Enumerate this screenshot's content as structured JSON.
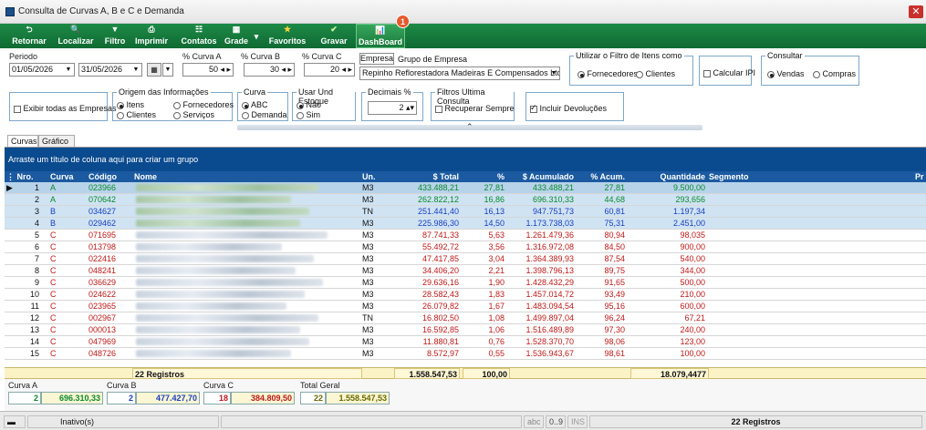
{
  "window": {
    "title": "Consulta de Curvas A, B e C e Demanda",
    "close": "✕"
  },
  "toolbar": {
    "items": [
      {
        "label": "Retornar",
        "icon": "back-arrow-icon",
        "glyph": "⮌"
      },
      {
        "label": "Localizar",
        "icon": "search-icon",
        "glyph": "🔍"
      },
      {
        "label": "Filtro",
        "icon": "filter-icon",
        "glyph": "▼"
      },
      {
        "label": "Imprimir",
        "icon": "printer-icon",
        "glyph": "⎙"
      },
      {
        "label": "Contatos",
        "icon": "contacts-icon",
        "glyph": "☷"
      },
      {
        "label": "Grade",
        "icon": "grid-icon",
        "glyph": "▦"
      },
      {
        "label": "Favoritos",
        "icon": "star-icon",
        "glyph": "★"
      },
      {
        "label": "Gravar",
        "icon": "check-icon",
        "glyph": "✔"
      },
      {
        "label": "DashBoard",
        "icon": "dashboard-icon",
        "glyph": "📊"
      }
    ],
    "badge": "1",
    "grade_arrow": "▾"
  },
  "filters": {
    "periodo_label": "Periodo",
    "date_from": "01/05/2026",
    "date_to": "31/05/2026",
    "curva_a_label": "% Curva A",
    "curva_a_value": "50",
    "curva_b_label": "% Curva B",
    "curva_b_value": "30",
    "curva_c_label": "% Curva C",
    "curva_c_value": "20",
    "empresa_tab": "Empresa",
    "grupo_tab": "Grupo de Empresa",
    "empresa_value": "Repinho Reflorestadora Madeiras E Compensados Ltda",
    "filtro_itens_title": "Utilizar o Filtro de Itens como",
    "opt_fornecedores": "Fornecedores",
    "opt_clientes": "Clientes",
    "calcular_ipi": "Calcular IPI",
    "consultar_title": "Consultar",
    "opt_vendas": "Vendas",
    "opt_compras": "Compras",
    "exibir_empresas": "Exibir todas as Empresas",
    "origem_title": "Origem das Informações",
    "origem_itens": "Itens",
    "origem_fornecedores": "Fornecedores",
    "origem_clientes": "Clientes",
    "origem_servicos": "Serviços",
    "curva_title": "Curva",
    "curva_abc": "ABC",
    "curva_demanda": "Demanda",
    "und_title": "Usar Und Estoque",
    "und_nao": "Não",
    "und_sim": "Sim",
    "decimais_title": "Decimais %",
    "decimais_value": "2",
    "filtros_title": "Filtros Ultima Consulta",
    "recuperar": "Recuperar Sempre",
    "incluir_devolucoes": "Incluir Devoluções",
    "collapse": "⌃"
  },
  "tabs": [
    "Curvas",
    "Gráfico"
  ],
  "group_hint": "Arraste um título de coluna aqui para criar um grupo",
  "grid": {
    "headers": {
      "nro": "Nro.",
      "curva": "Curva",
      "codigo": "Código",
      "nome": "Nome",
      "un": "Un.",
      "total": "$ Total",
      "pct": "%",
      "acum": "$ Acumulado",
      "pct_acum": "% Acum.",
      "qtd": "Quantidade",
      "segmento": "Segmento",
      "pr": "Pr"
    },
    "rows": [
      {
        "nro": "1",
        "curva": "A",
        "codigo": "023966",
        "un": "M3",
        "total": "433.488,21",
        "pct": "27,81",
        "acum": "433.488,21",
        "pct_acum": "27,81",
        "qtd": "9.500,00"
      },
      {
        "nro": "2",
        "curva": "A",
        "codigo": "070642",
        "un": "M3",
        "total": "262.822,12",
        "pct": "16,86",
        "acum": "696.310,33",
        "pct_acum": "44,68",
        "qtd": "293,656"
      },
      {
        "nro": "3",
        "curva": "B",
        "codigo": "034627",
        "un": "TN",
        "total": "251.441,40",
        "pct": "16,13",
        "acum": "947.751,73",
        "pct_acum": "60,81",
        "qtd": "1.197,34"
      },
      {
        "nro": "4",
        "curva": "B",
        "codigo": "029462",
        "un": "M3",
        "total": "225.986,30",
        "pct": "14,50",
        "acum": "1.173.738,03",
        "pct_acum": "75,31",
        "qtd": "2.451,00"
      },
      {
        "nro": "5",
        "curva": "C",
        "codigo": "071695",
        "un": "M3",
        "total": "87.741,33",
        "pct": "5,63",
        "acum": "1.261.479,36",
        "pct_acum": "80,94",
        "qtd": "98,035"
      },
      {
        "nro": "6",
        "curva": "C",
        "codigo": "013798",
        "un": "M3",
        "total": "55.492,72",
        "pct": "3,56",
        "acum": "1.316.972,08",
        "pct_acum": "84,50",
        "qtd": "900,00"
      },
      {
        "nro": "7",
        "curva": "C",
        "codigo": "022416",
        "un": "M3",
        "total": "47.417,85",
        "pct": "3,04",
        "acum": "1.364.389,93",
        "pct_acum": "87,54",
        "qtd": "540,00"
      },
      {
        "nro": "8",
        "curva": "C",
        "codigo": "048241",
        "un": "M3",
        "total": "34.406,20",
        "pct": "2,21",
        "acum": "1.398.796,13",
        "pct_acum": "89,75",
        "qtd": "344,00"
      },
      {
        "nro": "9",
        "curva": "C",
        "codigo": "036629",
        "un": "M3",
        "total": "29.636,16",
        "pct": "1,90",
        "acum": "1.428.432,29",
        "pct_acum": "91,65",
        "qtd": "500,00"
      },
      {
        "nro": "10",
        "curva": "C",
        "codigo": "024622",
        "un": "M3",
        "total": "28.582,43",
        "pct": "1,83",
        "acum": "1.457.014,72",
        "pct_acum": "93,49",
        "qtd": "210,00"
      },
      {
        "nro": "11",
        "curva": "C",
        "codigo": "023965",
        "un": "M3",
        "total": "26.079,82",
        "pct": "1,67",
        "acum": "1.483.094,54",
        "pct_acum": "95,16",
        "qtd": "600,00"
      },
      {
        "nro": "12",
        "curva": "C",
        "codigo": "002967",
        "un": "TN",
        "total": "16.802,50",
        "pct": "1,08",
        "acum": "1.499.897,04",
        "pct_acum": "96,24",
        "qtd": "67,21"
      },
      {
        "nro": "13",
        "curva": "C",
        "codigo": "000013",
        "un": "M3",
        "total": "16.592,85",
        "pct": "1,06",
        "acum": "1.516.489,89",
        "pct_acum": "97,30",
        "qtd": "240,00"
      },
      {
        "nro": "14",
        "curva": "C",
        "codigo": "047969",
        "un": "M3",
        "total": "11.880,81",
        "pct": "0,76",
        "acum": "1.528.370,70",
        "pct_acum": "98,06",
        "qtd": "123,00"
      },
      {
        "nro": "15",
        "curva": "C",
        "codigo": "048726",
        "un": "M3",
        "total": "8.572,97",
        "pct": "0,55",
        "acum": "1.536.943,67",
        "pct_acum": "98,61",
        "qtd": "100,00"
      }
    ],
    "totals": {
      "registros": "22 Registros",
      "total": "1.558.547,53",
      "pct": "100,00",
      "qtd": "18.079,4477"
    }
  },
  "summary": {
    "curva_a": {
      "label": "Curva A",
      "count": "2",
      "value": "696.310,33"
    },
    "curva_b": {
      "label": "Curva B",
      "count": "2",
      "value": "477.427,70"
    },
    "curva_c": {
      "label": "Curva C",
      "count": "18",
      "value": "384.809,50"
    },
    "total_geral": {
      "label": "Total Geral",
      "count": "22",
      "value": "1.558.547,53"
    }
  },
  "status": {
    "inativos": "Inativo(s)",
    "abc": "abc",
    "range": "0..9",
    "ins": "INS",
    "registros": "22 Registros"
  },
  "colors": {
    "toolbar": "#0f6a33",
    "grid_header": "#1b5aa0",
    "group_bar": "#0a4a8e",
    "curva_a": "#0a8a2e",
    "curva_b": "#1a3fc0",
    "curva_c": "#c01818"
  }
}
